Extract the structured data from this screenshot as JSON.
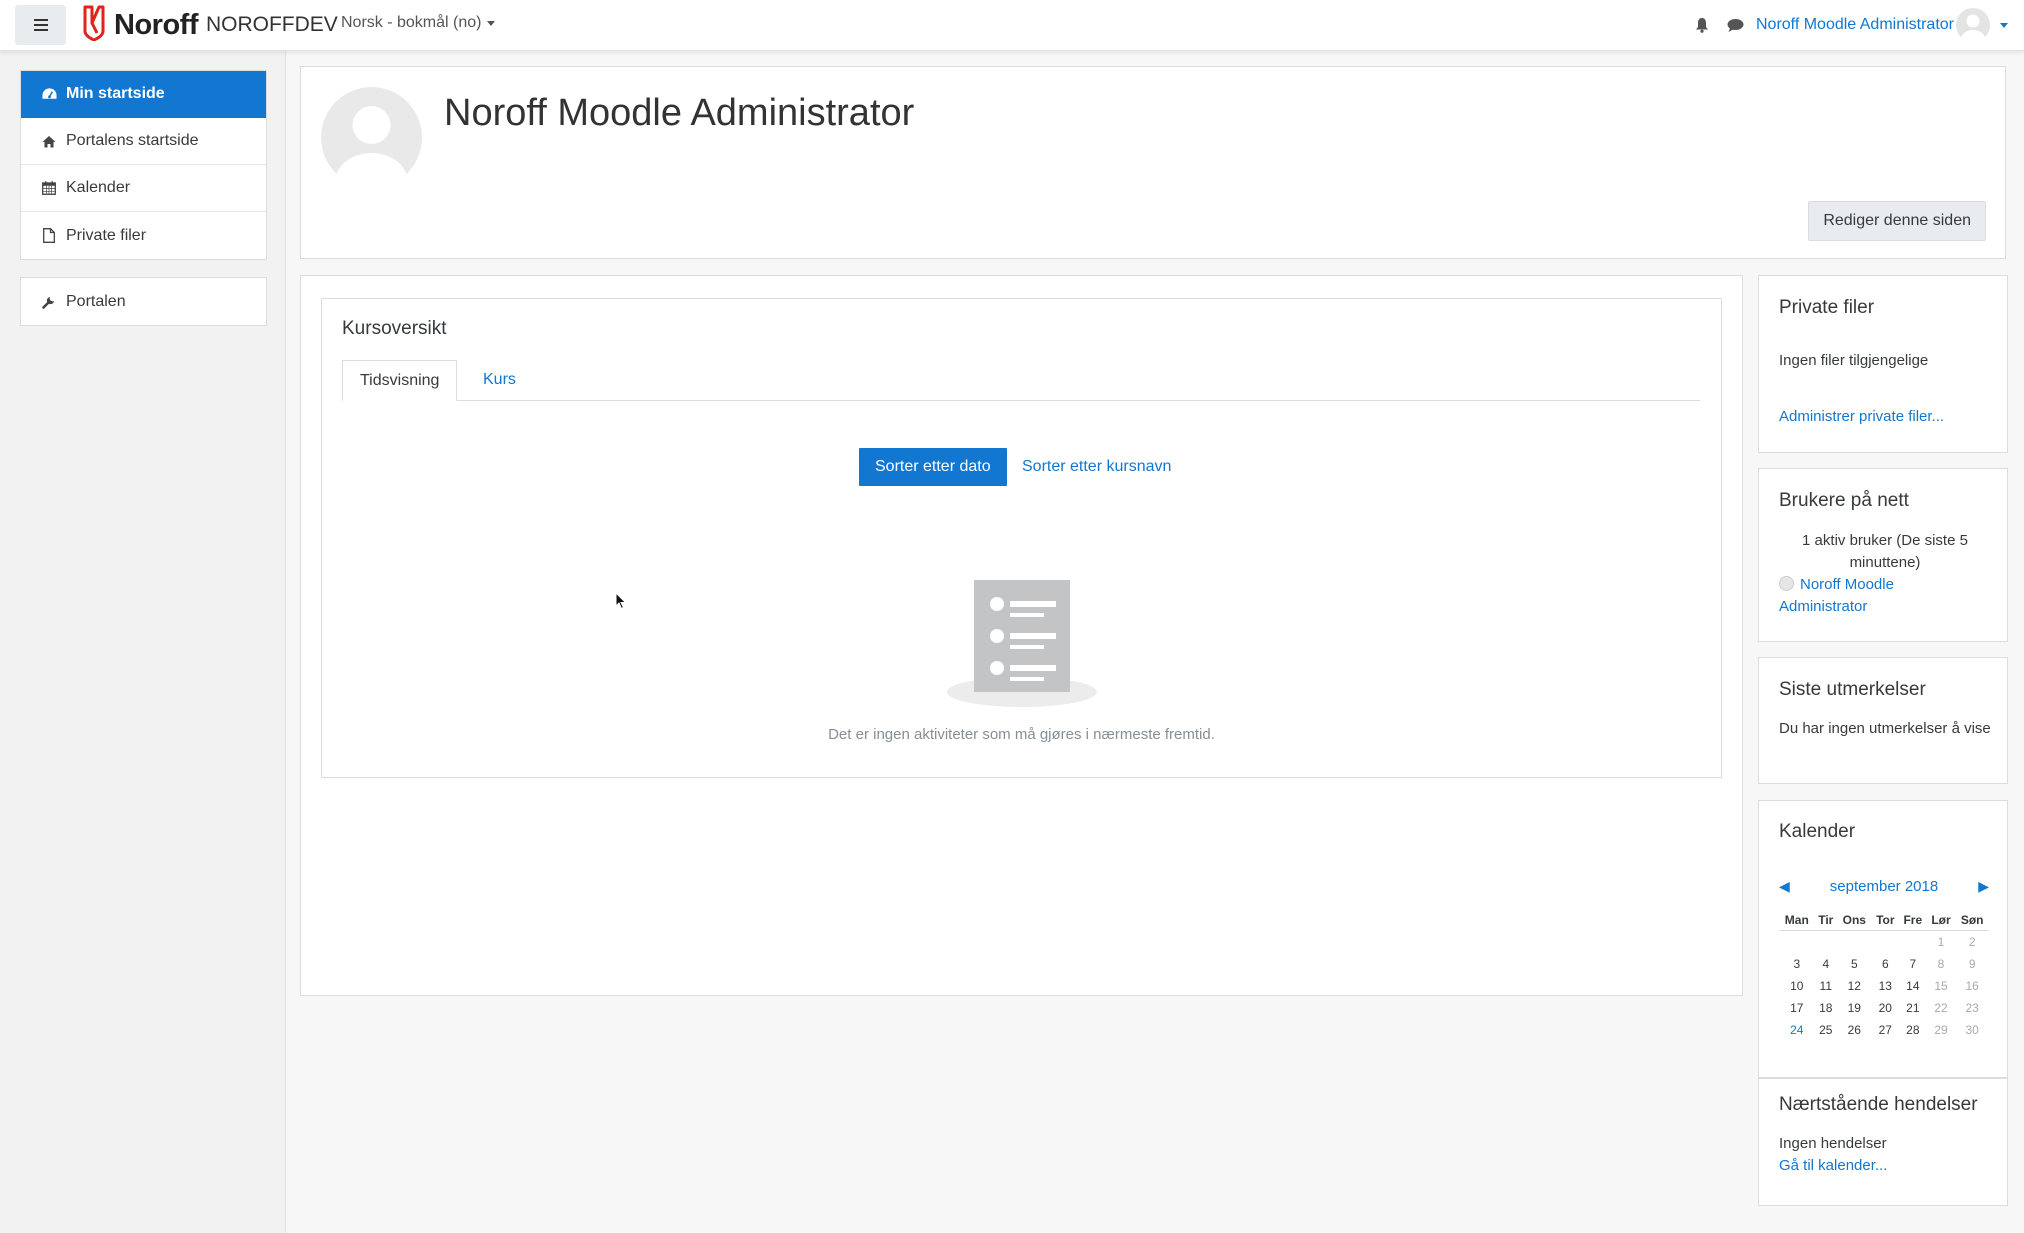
{
  "navbar": {
    "brand_name": "Noroff",
    "site_name": "NOROFFDEV",
    "language": "Norsk - bokmål (no)",
    "user_name": "Noroff Moodle Administrator",
    "icons": [
      "menu-icon",
      "bell-icon",
      "chat-icon"
    ]
  },
  "sidebar": {
    "items": [
      {
        "label": "Min startside",
        "icon": "dashboard-icon",
        "active": true
      },
      {
        "label": "Portalens startside",
        "icon": "home-icon"
      },
      {
        "label": "Kalender",
        "icon": "calendar-icon"
      },
      {
        "label": "Private filer",
        "icon": "file-icon"
      }
    ],
    "admin_items": [
      {
        "label": "Portalen",
        "icon": "wrench-icon"
      }
    ]
  },
  "header": {
    "title": "Noroff Moodle Administrator",
    "edit_button": "Rediger denne siden"
  },
  "course_overview": {
    "title": "Kursoversikt",
    "tabs": [
      {
        "label": "Tidsvisning",
        "active": true
      },
      {
        "label": "Kurs",
        "active": false
      }
    ],
    "sort_by_date": "Sorter etter dato",
    "sort_by_name": "Sorter etter kursnavn",
    "empty_message": "Det er ingen aktiviteter som må gjøres i nærmeste fremtid."
  },
  "blocks": {
    "private_files": {
      "title": "Private filer",
      "text": "Ingen filer tilgjengelige",
      "link": "Administrer private filer..."
    },
    "online_users": {
      "title": "Brukere på nett",
      "text": "1 aktiv bruker (De siste 5 minuttene)",
      "user": "Noroff Moodle Administrator"
    },
    "badges": {
      "title": "Siste utmerkelser",
      "text": "Du har ingen utmerkelser å vise"
    },
    "calendar": {
      "title": "Kalender",
      "month": "september 2018",
      "prev": "◀",
      "next": "▶",
      "weekdays": [
        "Man",
        "Tir",
        "Ons",
        "Tor",
        "Fre",
        "Lør",
        "Søn"
      ],
      "weeks": [
        [
          "",
          "",
          "",
          "",
          "",
          "1",
          "2"
        ],
        [
          "3",
          "4",
          "5",
          "6",
          "7",
          "8",
          "9"
        ],
        [
          "10",
          "11",
          "12",
          "13",
          "14",
          "15",
          "16"
        ],
        [
          "17",
          "18",
          "19",
          "20",
          "21",
          "22",
          "23"
        ],
        [
          "24",
          "25",
          "26",
          "27",
          "28",
          "29",
          "30"
        ]
      ],
      "today": "24"
    },
    "upcoming": {
      "title": "Nærtstående hendelser",
      "text": "Ingen hendelser",
      "link": "Gå til kalender..."
    }
  },
  "colors": {
    "accent": "#1177d1",
    "logo_red": "#e2231a"
  }
}
